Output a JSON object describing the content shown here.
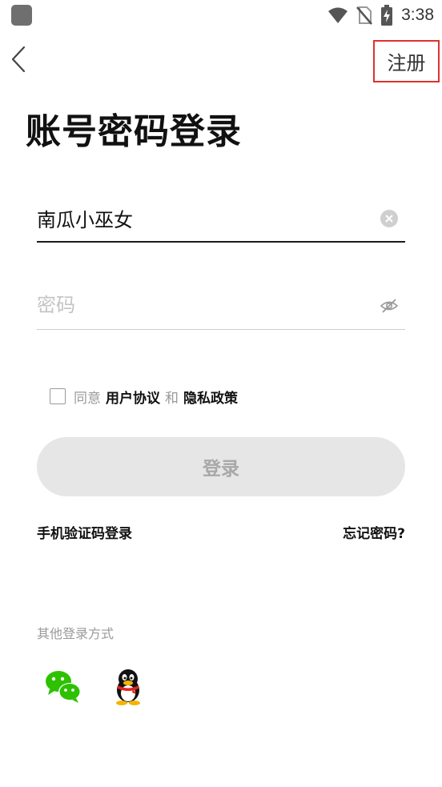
{
  "status_bar": {
    "time": "3:38",
    "icons": [
      "wifi-icon",
      "no-sim-icon",
      "battery-charging-icon"
    ]
  },
  "nav": {
    "back_icon": "chevron-left-icon",
    "register_label": "注册"
  },
  "page": {
    "title": "账号密码登录"
  },
  "form": {
    "username_value": "南瓜小巫女",
    "username_clear_icon": "clear-circle-icon",
    "password_value": "",
    "password_placeholder": "密码",
    "password_toggle_icon": "eye-off-icon"
  },
  "agreement": {
    "agree_text": "同意",
    "user_agreement": "用户协议",
    "and_text": "和",
    "privacy_policy": "隐私政策"
  },
  "login_button_label": "登录",
  "links": {
    "sms_login": "手机验证码登录",
    "forgot_password": "忘记密码?"
  },
  "other_login": {
    "label": "其他登录方式",
    "providers": [
      "wechat-icon",
      "qq-icon"
    ]
  },
  "colors": {
    "highlight_border": "#e0302f",
    "wechat_green": "#2dc100",
    "button_disabled_bg": "#e6e6e6"
  }
}
